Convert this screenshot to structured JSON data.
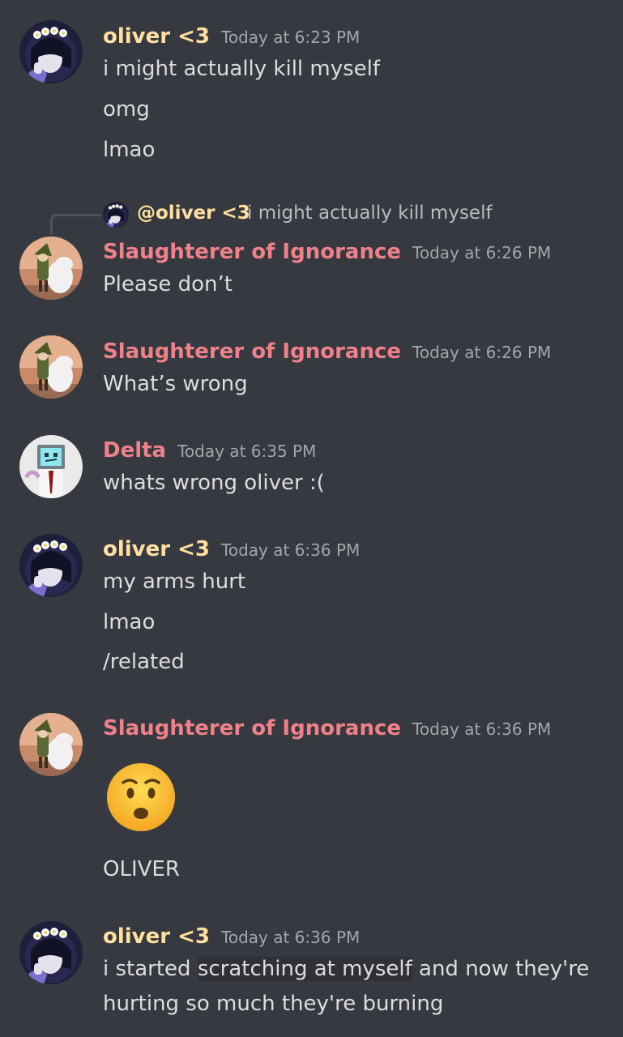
{
  "colors": {
    "background": "#36393f",
    "oliver_name": "#ffe0a0",
    "slaughterer_name": "#f0808a",
    "delta_name": "#f0808a",
    "timestamp": "#a3a6aa",
    "text": "#dcddde"
  },
  "messages": [
    {
      "author": "oliver <3",
      "time": "Today at 6:23 PM",
      "lines": [
        "i might actually kill myself",
        "omg",
        "lmao"
      ]
    },
    {
      "reply": {
        "mention": "@oliver <3",
        "text": "i might actually kill myself"
      },
      "author": "Slaughterer of Ignorance",
      "time": "Today at 6:26 PM",
      "lines": [
        "Please don’t"
      ]
    },
    {
      "author": "Slaughterer of Ignorance",
      "time": "Today at 6:26 PM",
      "lines": [
        "What’s wrong"
      ]
    },
    {
      "author": "Delta",
      "time": "Today at 6:35 PM",
      "lines": [
        "whats wrong oliver :("
      ]
    },
    {
      "author": "oliver <3",
      "time": "Today at 6:36 PM",
      "lines": [
        "my arms hurt",
        "lmao",
        "/related"
      ]
    },
    {
      "author": "Slaughterer of Ignorance",
      "time": "Today at 6:36 PM",
      "emoji": "hushed-face-emoji",
      "lines": [
        "OLIVER"
      ]
    },
    {
      "author": "oliver <3",
      "time": "Today at 6:36 PM",
      "lines_parts": {
        "line1_pre": "i started ",
        "line1_hl": "scratching at myself",
        "line1_post": " and now they're",
        "line2": "hurting so much they're burning"
      }
    }
  ]
}
